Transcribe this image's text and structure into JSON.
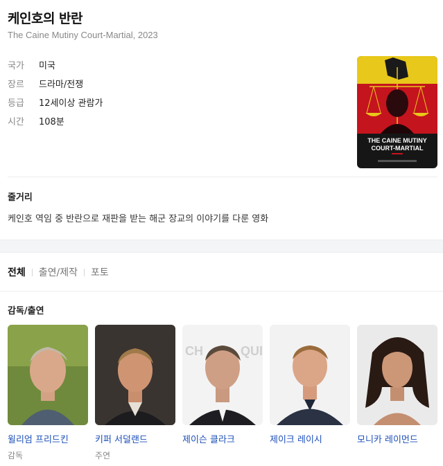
{
  "movie": {
    "title": "케인호의 반란",
    "subtitle": "The Caine Mutiny Court-Martial, 2023",
    "info": [
      {
        "key": "국가",
        "value": "미국"
      },
      {
        "key": "장르",
        "value": "드라마/전쟁"
      },
      {
        "key": "등급",
        "value": "12세이상 관람가"
      },
      {
        "key": "시간",
        "value": "108분"
      }
    ],
    "poster": {
      "title_line1": "THE CAINE MUTINY",
      "title_line2": "COURT-MARTIAL",
      "colors": {
        "top": "#e8c81a",
        "middle": "#c4141e",
        "bottom": "#161616"
      }
    }
  },
  "synopsis": {
    "heading": "줄거리",
    "text": "케인호 역임 중 반란으로 재판을 받는 해군 장교의 이야기를 다룬 영화"
  },
  "tabs": [
    {
      "label": "전체",
      "active": true
    },
    {
      "label": "출연/제작",
      "active": false
    },
    {
      "label": "포토",
      "active": false
    }
  ],
  "cast_section": {
    "heading": "감독/출연",
    "people": [
      {
        "name": "윌리엄 프리드킨",
        "role": "감독"
      },
      {
        "name": "키퍼 서덜랜드",
        "role": "주연"
      },
      {
        "name": "제이슨 클라크",
        "role": ""
      },
      {
        "name": "제이크 레이시",
        "role": ""
      },
      {
        "name": "모니카 레이먼드",
        "role": ""
      }
    ]
  },
  "colors": {
    "link": "#1c4fb8",
    "muted": "#888888"
  }
}
